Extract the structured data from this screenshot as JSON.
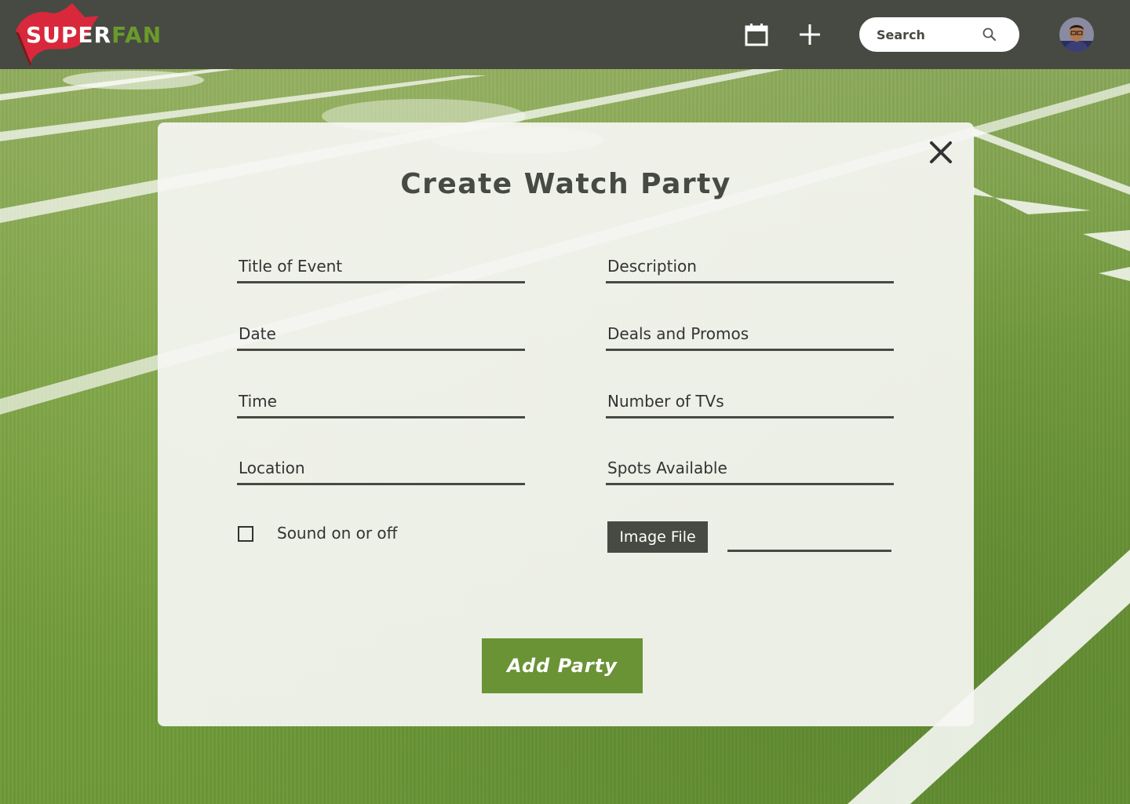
{
  "header": {
    "logo": {
      "part1": "SUPER",
      "part2": "FAN",
      "icon": "pennant-flag-icon"
    },
    "calendar_icon": "calendar-icon",
    "add_icon": "plus-icon",
    "search": {
      "placeholder": "Search",
      "icon": "search-icon"
    },
    "avatar_icon": "user-avatar"
  },
  "modal": {
    "title": "Create Watch Party",
    "close_icon": "close-icon",
    "fields_left": [
      {
        "placeholder": "Title of Event"
      },
      {
        "placeholder": "Date"
      },
      {
        "placeholder": "Time"
      },
      {
        "placeholder": "Location"
      }
    ],
    "fields_right": [
      {
        "placeholder": "Description"
      },
      {
        "placeholder": "Deals and Promos"
      },
      {
        "placeholder": "Number of TVs"
      },
      {
        "placeholder": "Spots Available"
      }
    ],
    "sound_checkbox": {
      "label": "Sound on or off",
      "checked": false
    },
    "image_file_label": "Image File",
    "submit_label": "Add Party"
  },
  "colors": {
    "header_bg": "#464a42",
    "accent_green": "#6a9335",
    "logo_red": "#d9283b",
    "text_dark": "#464a42"
  }
}
